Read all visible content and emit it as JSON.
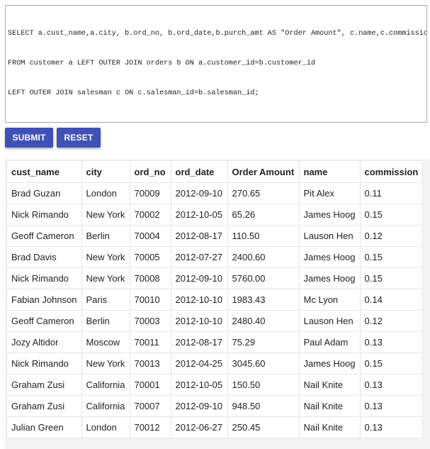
{
  "sql_editor": {
    "lines": [
      "SELECT a.cust_name,a.city, b.ord_no, b.ord_date,b.purch_amt AS \"Order Amount\", c.name,c.commission",
      "FROM customer a LEFT OUTER JOIN orders b ON a.customer_id=b.customer_id",
      "LEFT OUTER JOIN salesman c ON c.salesman_id=b.salesman_id;"
    ]
  },
  "buttons": {
    "submit": "SUBMIT",
    "reset": "RESET"
  },
  "results": {
    "columns": [
      "cust_name",
      "city",
      "ord_no",
      "ord_date",
      "Order Amount",
      "name",
      "commission"
    ],
    "rows": [
      [
        "Brad Guzan",
        "London",
        "70009",
        "2012-09-10",
        "270.65",
        "Pit Alex",
        "0.11"
      ],
      [
        "Nick Rimando",
        "New York",
        "70002",
        "2012-10-05",
        "65.26",
        "James Hoog",
        "0.15"
      ],
      [
        "Geoff Cameron",
        "Berlin",
        "70004",
        "2012-08-17",
        "110.50",
        "Lauson Hen",
        "0.12"
      ],
      [
        "Brad Davis",
        "New York",
        "70005",
        "2012-07-27",
        "2400.60",
        "James Hoog",
        "0.15"
      ],
      [
        "Nick Rimando",
        "New York",
        "70008",
        "2012-09-10",
        "5760.00",
        "James Hoog",
        "0.15"
      ],
      [
        "Fabian Johnson",
        "Paris",
        "70010",
        "2012-10-10",
        "1983.43",
        "Mc Lyon",
        "0.14"
      ],
      [
        "Geoff Cameron",
        "Berlin",
        "70003",
        "2012-10-10",
        "2480.40",
        "Lauson Hen",
        "0.12"
      ],
      [
        "Jozy Altidor",
        "Moscow",
        "70011",
        "2012-08-17",
        "75.29",
        "Paul Adam",
        "0.13"
      ],
      [
        "Nick Rimando",
        "New York",
        "70013",
        "2012-04-25",
        "3045.60",
        "James Hoog",
        "0.15"
      ],
      [
        "Graham Zusi",
        "California",
        "70001",
        "2012-10-05",
        "150.50",
        "Nail Knite",
        "0.13"
      ],
      [
        "Graham Zusi",
        "California",
        "70007",
        "2012-09-10",
        "948.50",
        "Nail Knite",
        "0.13"
      ],
      [
        "Julian Green",
        "London",
        "70012",
        "2012-06-27",
        "250.45",
        "Nail Knite",
        "0.13"
      ]
    ]
  },
  "colors": {
    "button_bg": "#3f51b5",
    "button_text": "#ffffff",
    "border": "#e6e6e6"
  }
}
